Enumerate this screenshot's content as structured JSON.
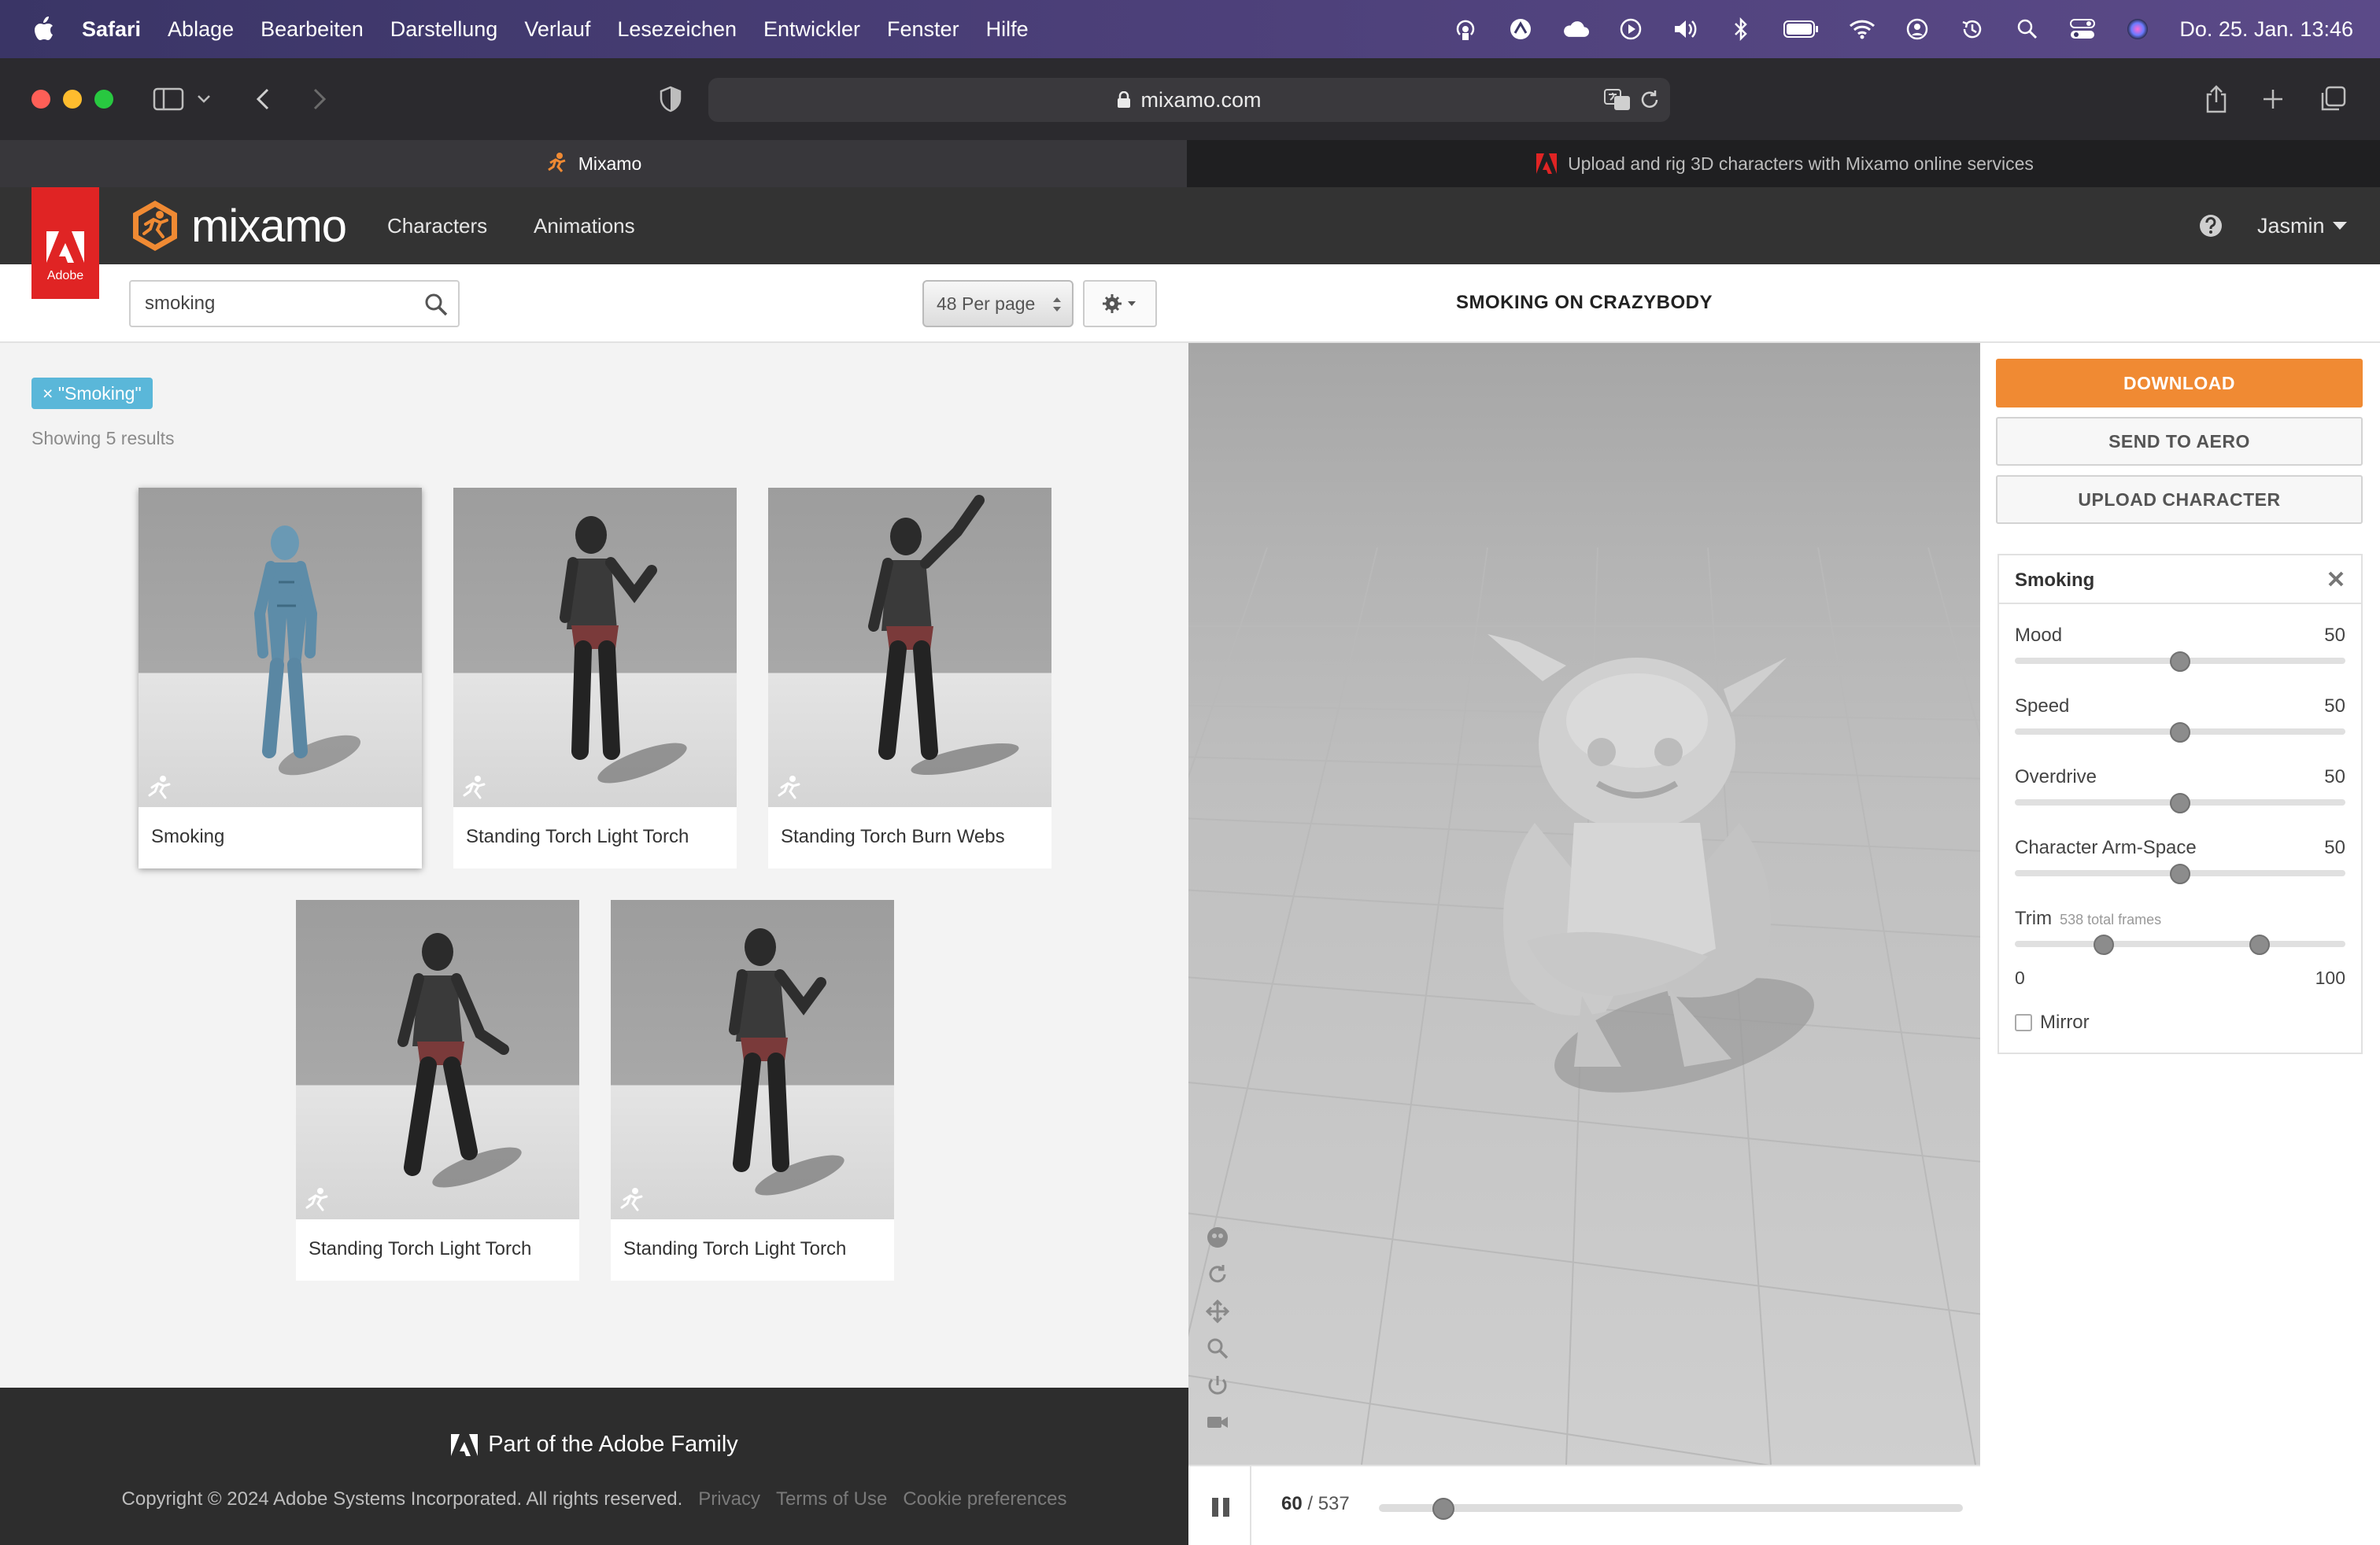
{
  "menubar": {
    "app": "Safari",
    "items": [
      "Ablage",
      "Bearbeiten",
      "Darstellung",
      "Verlauf",
      "Lesezeichen",
      "Entwickler",
      "Fenster",
      "Hilfe"
    ],
    "clock": "Do. 25. Jan.  13:46",
    "status_icons": [
      "airdrop-icon",
      "vpn-icon",
      "icloud-icon",
      "play-icon",
      "volume-icon",
      "bluetooth-icon",
      "battery-icon",
      "wifi-icon",
      "user-icon",
      "time-machine-icon",
      "spotlight-icon",
      "control-center-icon",
      "siri-icon"
    ]
  },
  "browser": {
    "url": "mixamo.com",
    "tabs": [
      {
        "title": "Mixamo",
        "active": true
      },
      {
        "title": "Upload and rig 3D characters with Mixamo online services",
        "active": false
      }
    ]
  },
  "header": {
    "adobe_label": "Adobe",
    "logo_text": "mixamo",
    "nav": [
      "Characters",
      "Animations"
    ],
    "user": "Jasmin"
  },
  "search": {
    "value": "smoking",
    "placeholder": "Search",
    "per_page": "48 Per page"
  },
  "filter_chip": "× \"Smoking\"",
  "results_text": "Showing 5 results",
  "cards": [
    {
      "title": "Smoking",
      "selected": true,
      "figure": "robot"
    },
    {
      "title": "Standing Torch Light Torch",
      "selected": false,
      "figure": "hooded"
    },
    {
      "title": "Standing Torch Burn Webs",
      "selected": false,
      "figure": "hooded-raised"
    },
    {
      "title": "Standing Torch Light Torch",
      "selected": false,
      "figure": "hooded-walk"
    },
    {
      "title": "Standing Torch Light Torch",
      "selected": false,
      "figure": "hooded"
    }
  ],
  "footer": {
    "family": "Part of the Adobe Family",
    "copyright": "Copyright © 2024 Adobe Systems Incorporated. All rights reserved.",
    "links": [
      "Privacy",
      "Terms of Use",
      "Cookie preferences"
    ]
  },
  "preview": {
    "title": "SMOKING ON CRAZYBODY",
    "current_frame": "60",
    "total_frames": "/ 537",
    "playhead_fraction": 0.111
  },
  "actions": {
    "download": "DOWNLOAD",
    "send_to_aero": "SEND TO AERO",
    "upload_character": "UPLOAD CHARACTER"
  },
  "settings": {
    "title": "Smoking",
    "params": [
      {
        "label": "Mood",
        "value": "50"
      },
      {
        "label": "Speed",
        "value": "50"
      },
      {
        "label": "Overdrive",
        "value": "50"
      },
      {
        "label": "Character Arm-Space",
        "value": "50"
      }
    ],
    "trim": {
      "label": "Trim",
      "sub": "538 total frames",
      "min": "0",
      "max": "100",
      "start_fraction": 0.27,
      "end_fraction": 0.74
    },
    "mirror_label": "Mirror",
    "mirror_checked": false
  },
  "colors": {
    "accent_orange": "#f08a33",
    "chip_blue": "#5ab7d9",
    "adobe_red": "#e02424"
  }
}
